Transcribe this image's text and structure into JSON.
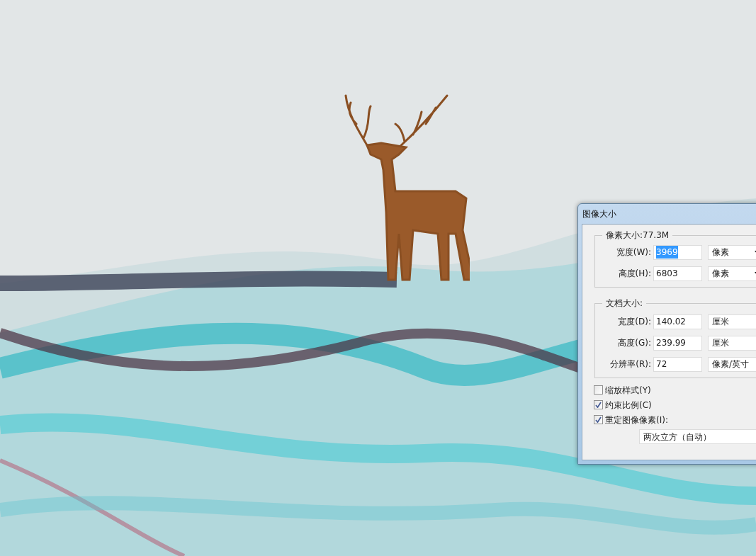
{
  "dialog": {
    "title": "图像大小",
    "pixel_dimensions": {
      "legend": "像素大小:77.3M",
      "rows": [
        {
          "label": "宽度(W):",
          "value": "3969",
          "selected": true,
          "unit": "像素",
          "caret": true
        },
        {
          "label": "高度(H):",
          "value": "6803",
          "selected": false,
          "unit": "像素",
          "caret": true
        }
      ]
    },
    "document_size": {
      "legend": "文档大小:",
      "rows": [
        {
          "label": "宽度(D):",
          "value": "140.02",
          "selected": false,
          "unit": "厘米",
          "caret": false
        },
        {
          "label": "高度(G):",
          "value": "239.99",
          "selected": false,
          "unit": "厘米",
          "caret": false
        },
        {
          "label": "分辨率(R):",
          "value": "72",
          "selected": false,
          "unit": "像素/英寸",
          "caret": false
        }
      ]
    },
    "options": [
      {
        "label": "缩放样式(Y)",
        "checked": false
      },
      {
        "label": "约束比例(C)",
        "checked": true
      },
      {
        "label": "重定图像像素(I):",
        "checked": true
      }
    ],
    "resample_method": "两次立方（自动）"
  }
}
